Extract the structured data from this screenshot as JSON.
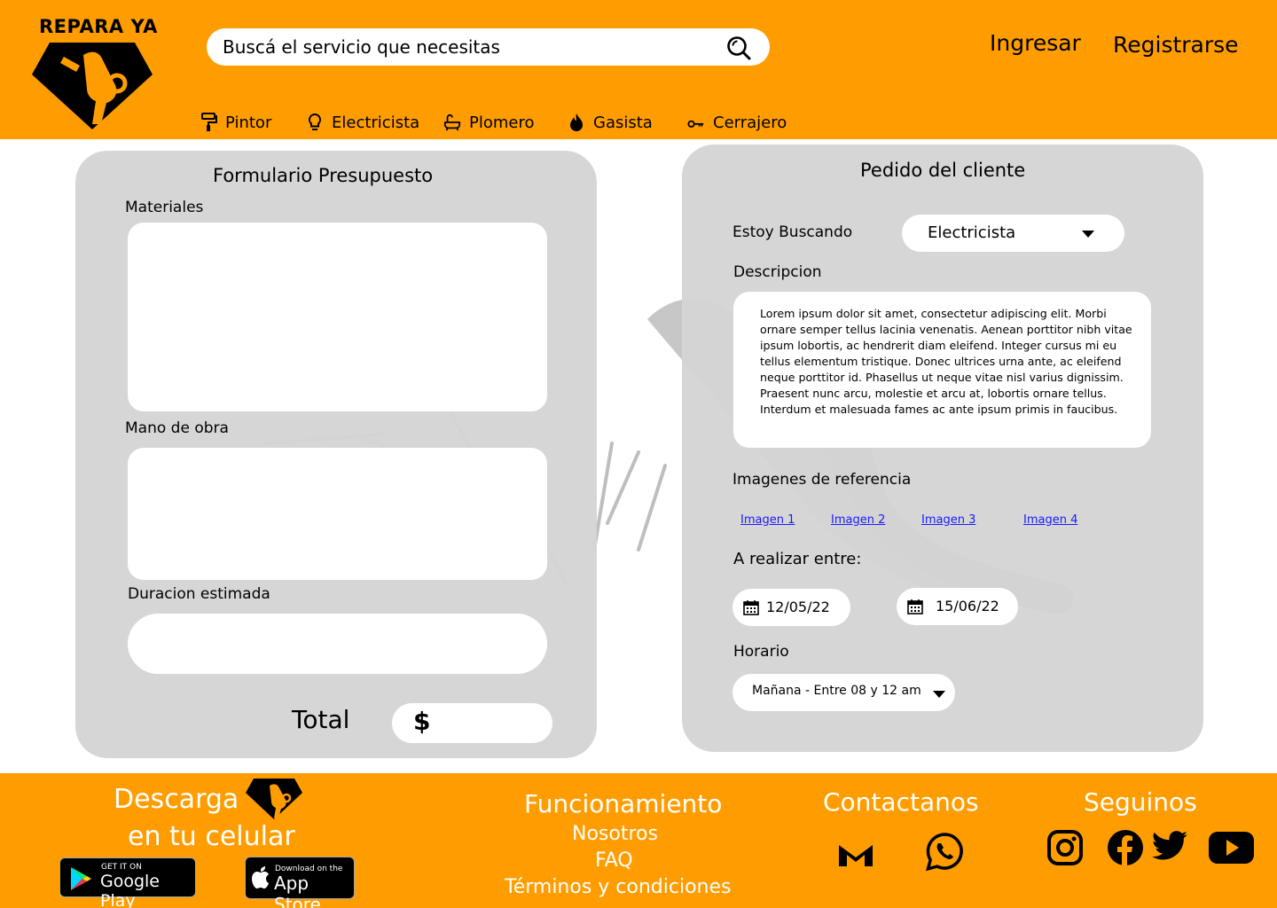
{
  "header": {
    "logo_text": "REPARA YA",
    "search": {
      "placeholder": "Buscá el servicio que necesitas"
    },
    "login_label": "Ingresar",
    "register_label": "Registrarse",
    "nav": [
      {
        "label": "Pintor",
        "icon": "paint-roller-icon"
      },
      {
        "label": "Electricista",
        "icon": "lightbulb-icon"
      },
      {
        "label": "Plomero",
        "icon": "bathtub-icon"
      },
      {
        "label": "Gasista",
        "icon": "flame-icon"
      },
      {
        "label": "Cerrajero",
        "icon": "key-icon"
      }
    ]
  },
  "budget_form": {
    "title": "Formulario Presupuesto",
    "materials_label": "Materiales",
    "labor_label": "Mano de obra",
    "duration_label": "Duracion estimada",
    "total_label": "Total",
    "currency_symbol": "$"
  },
  "client_request": {
    "title": "Pedido del cliente",
    "looking_for_label": "Estoy Buscando",
    "looking_for_value": "Electricista",
    "description_label": "Descripcion",
    "description_text": "Lorem ipsum dolor sit amet, consectetur adipiscing elit. Morbi ornare semper tellus lacinia venenatis. Aenean porttitor nibh vitae ipsum lobortis, ac hendrerit diam eleifend. Integer cursus mi eu tellus elementum tristique. Donec ultrices urna ante, ac eleifend neque porttitor id. Phasellus ut neque vitae nisl varius dignissim. Praesent nunc arcu, molestie et arcu at, lobortis ornare tellus. Interdum et malesuada fames ac ante ipsum primis in faucibus.",
    "images_label": "Imagenes de referencia",
    "images": [
      "Imagen 1",
      "Imagen 2",
      "Imagen 3",
      "Imagen 4"
    ],
    "date_range_label": "A realizar entre:",
    "date_from": "12/05/22",
    "date_to": "15/06/22",
    "schedule_label": "Horario",
    "schedule_value": "Mañana - Entre 08 y 12 am"
  },
  "footer": {
    "download_line1": "Descarga",
    "download_line2": "en tu celular",
    "google_play": {
      "small": "GET IT ON",
      "big": "Google Play"
    },
    "app_store": {
      "small": "Download on the",
      "big": "App Store"
    },
    "links_title": "Funcionamiento",
    "links": [
      "Nosotros",
      "FAQ",
      "Términos y condiciones"
    ],
    "contact_title": "Contactanos",
    "follow_title": "Seguinos"
  },
  "colors": {
    "brand_orange": "#FF9D00",
    "panel_gray": "#D4D4D4",
    "link_blue": "#1A1AFF"
  }
}
